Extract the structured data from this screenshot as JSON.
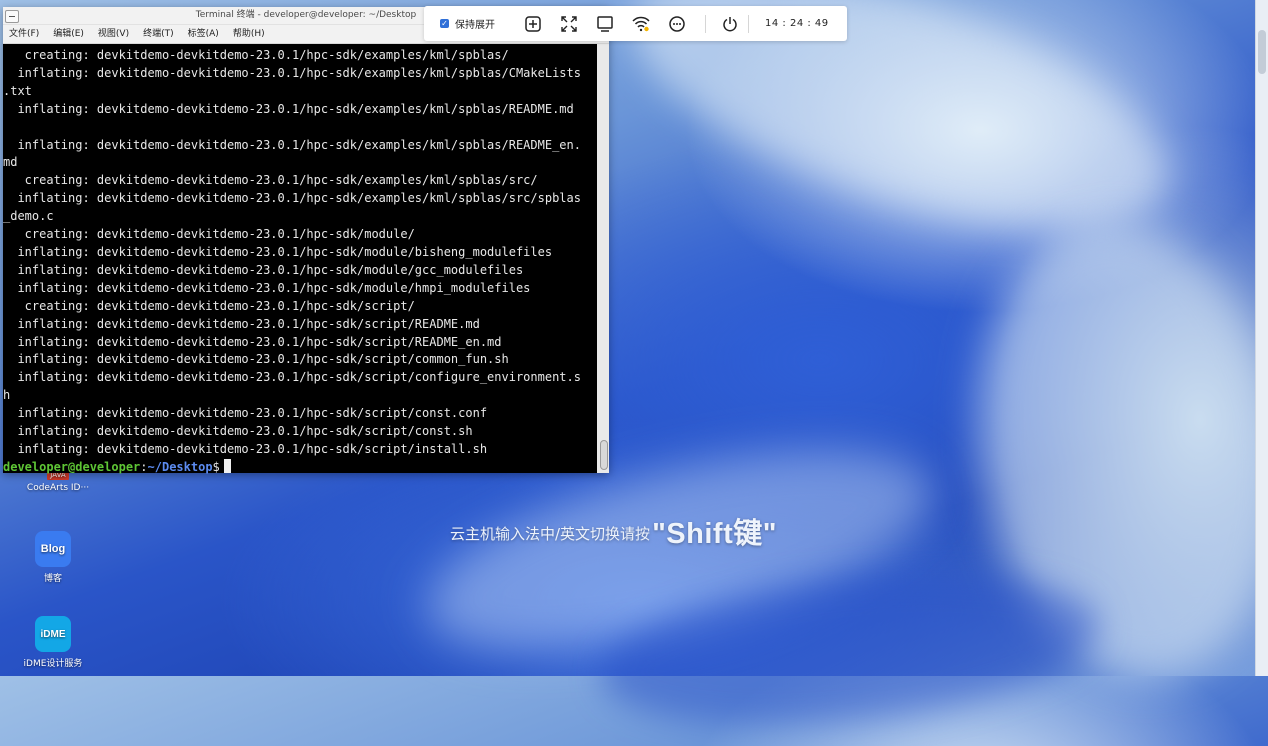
{
  "terminal": {
    "title": "Terminal 终端 - developer@developer: ~/Desktop",
    "menu": [
      "文件(F)",
      "编辑(E)",
      "视图(V)",
      "终端(T)",
      "标签(A)",
      "帮助(H)"
    ],
    "lines": [
      "   creating: devkitdemo-devkitdemo-23.0.1/hpc-sdk/examples/kml/spblas/",
      "  inflating: devkitdemo-devkitdemo-23.0.1/hpc-sdk/examples/kml/spblas/CMakeLists",
      ".txt",
      "  inflating: devkitdemo-devkitdemo-23.0.1/hpc-sdk/examples/kml/spblas/README.md",
      "",
      "  inflating: devkitdemo-devkitdemo-23.0.1/hpc-sdk/examples/kml/spblas/README_en.",
      "md",
      "   creating: devkitdemo-devkitdemo-23.0.1/hpc-sdk/examples/kml/spblas/src/",
      "  inflating: devkitdemo-devkitdemo-23.0.1/hpc-sdk/examples/kml/spblas/src/spblas",
      "_demo.c",
      "   creating: devkitdemo-devkitdemo-23.0.1/hpc-sdk/module/",
      "  inflating: devkitdemo-devkitdemo-23.0.1/hpc-sdk/module/bisheng_modulefiles",
      "  inflating: devkitdemo-devkitdemo-23.0.1/hpc-sdk/module/gcc_modulefiles",
      "  inflating: devkitdemo-devkitdemo-23.0.1/hpc-sdk/module/hmpi_modulefiles",
      "   creating: devkitdemo-devkitdemo-23.0.1/hpc-sdk/script/",
      "  inflating: devkitdemo-devkitdemo-23.0.1/hpc-sdk/script/README.md",
      "  inflating: devkitdemo-devkitdemo-23.0.1/hpc-sdk/script/README_en.md",
      "  inflating: devkitdemo-devkitdemo-23.0.1/hpc-sdk/script/common_fun.sh",
      "  inflating: devkitdemo-devkitdemo-23.0.1/hpc-sdk/script/configure_environment.s",
      "h",
      "  inflating: devkitdemo-devkitdemo-23.0.1/hpc-sdk/script/const.conf",
      "  inflating: devkitdemo-devkitdemo-23.0.1/hpc-sdk/script/const.sh",
      "  inflating: devkitdemo-devkitdemo-23.0.1/hpc-sdk/script/install.sh"
    ],
    "prompt_user": "developer@developer",
    "prompt_sep": ":",
    "prompt_path": "~/Desktop",
    "prompt_symbol": "$"
  },
  "toolbar": {
    "keep_label": "保持展开",
    "time": "14 : 24 : 49",
    "icons": [
      "add-window-icon",
      "fullscreen-icon",
      "monitor-icon",
      "wifi-icon",
      "more-icon",
      "power-icon"
    ]
  },
  "desktop": {
    "icons": [
      {
        "label": "CodeArts ID···",
        "tag": "JAVA"
      },
      {
        "label": "博客",
        "tile_text": "Blog"
      },
      {
        "label": "iDME设计服务",
        "tile_text": "iDME"
      }
    ],
    "hint_text": "云主机输入法中/英文切换请按",
    "hint_key": "\"Shift键\""
  },
  "colors": {
    "prompt_user": "#5ec535",
    "prompt_path": "#5c8bf0",
    "accent": "#2f6fd8"
  }
}
